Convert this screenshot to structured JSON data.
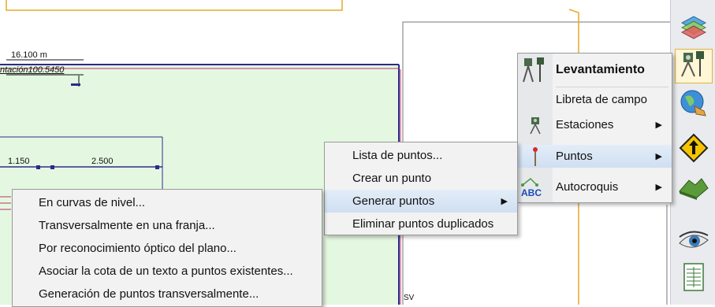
{
  "canvas": {
    "dim_top_value": "16.100 m",
    "dim_top_label": "ntación100.5450",
    "dim_left_value": "1.150",
    "dim_mid_value": "2.500",
    "corner_label": "SV"
  },
  "main_menu": {
    "title": "Levantamiento",
    "items": [
      {
        "label": "Libreta de campo"
      },
      {
        "label": "Estaciones"
      },
      {
        "label": "Puntos"
      },
      {
        "label": "Autocroquis"
      }
    ]
  },
  "puntos_menu": {
    "items": [
      {
        "label": "Lista de puntos..."
      },
      {
        "label": "Crear un punto"
      },
      {
        "label": "Generar puntos"
      },
      {
        "label": "Eliminar puntos duplicados"
      }
    ]
  },
  "generar_menu": {
    "items": [
      {
        "label": "En curvas de nivel..."
      },
      {
        "label": "Transversalmente en una franja..."
      },
      {
        "label": "Por reconocimiento óptico del plano..."
      },
      {
        "label": "Asociar la cota de un texto a puntos existentes..."
      },
      {
        "label": "Generación de puntos transversalmente..."
      }
    ]
  },
  "toolbar": {
    "buttons": [
      {
        "icon": "layers-icon"
      },
      {
        "icon": "survey-instrument-icon"
      },
      {
        "icon": "globe-icon"
      },
      {
        "icon": "road-sign-icon"
      },
      {
        "icon": "terrain-icon"
      },
      {
        "icon": "eye-icon"
      },
      {
        "icon": "spreadsheet-icon"
      }
    ]
  },
  "colors": {
    "green_fill": "#e4f8e1",
    "plan_line": "#2e2a8a",
    "orange_line": "#e6a92a",
    "menu_bg": "#f2f2f2",
    "highlight": "#d6e4f5"
  }
}
